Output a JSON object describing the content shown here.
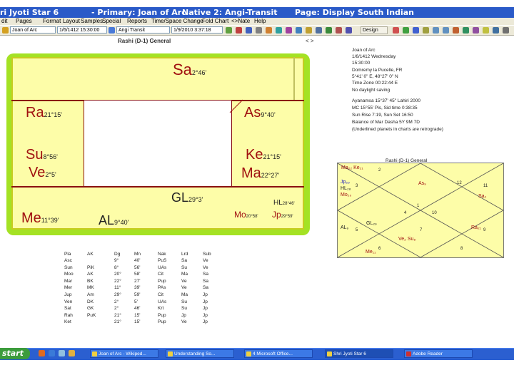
{
  "window": {
    "app": "ri Jyoti Star 6",
    "primary": "- Primary: Joan of Arc",
    "native2": "Native 2: Angi-Transit",
    "page": "Page: Display South Indian"
  },
  "menu": [
    "dit",
    "Pages",
    "Format",
    "Layout",
    "Samples",
    "Special",
    "Reports",
    "Time/Space Change",
    "Fold Chart",
    "<>Nate",
    "Help"
  ],
  "toolbar": {
    "native1": "Joan of Arc",
    "date1": "1/6/1412 15:30:00",
    "native2": "Angi Transit",
    "date2": "1/9/2010 3:37:18",
    "design_label": "Design"
  },
  "chart_header": {
    "title": "Rashi (D-1) General",
    "nav": "< >"
  },
  "south_chart": {
    "sa": {
      "name": "Sa",
      "deg": "2°46'"
    },
    "ra": {
      "name": "Ra",
      "deg": "21°15'"
    },
    "as": {
      "name": "As",
      "deg": "9°40'"
    },
    "su": {
      "name": "Su",
      "deg": "8°56'"
    },
    "ve": {
      "name": "Ve",
      "deg": "2°5'"
    },
    "ke": {
      "name": "Ke",
      "deg": "21°15'"
    },
    "ma": {
      "name": "Ma",
      "deg": "22°27'"
    },
    "gl": {
      "name": "GL",
      "deg": "29°3'"
    },
    "hl": {
      "name": "HL",
      "deg": "28°46'"
    },
    "me": {
      "name": "Me",
      "deg": "11°39'"
    },
    "al": {
      "name": "AL",
      "deg": "9°40'"
    },
    "mo": {
      "name": "Mo",
      "deg": "20°58'"
    },
    "jp": {
      "name": "Jp",
      "deg": "29°59'"
    }
  },
  "info": [
    "Joan of Arc",
    "1/6/1412 Wednesday",
    "15:30:00",
    "Domremy la Pucelle, FR",
    "5°41' 0\" E, 48°27' 0\" N",
    "Time Zone 00:22:44 E",
    "No daylight saving",
    "Ayanamsa 15°37' 45\" Lahiri 2000",
    "MC 15°55' Pis, Sid time 0:38:35",
    "Sun Rise 7:19, Sun Set 16:50",
    "Balance of Mar Dasha 5Y 9M 7D",
    "(Underlined planets in charts are retrograde)"
  ],
  "north_chart": {
    "title": "Rashi (D-1) General",
    "planets": {
      "ma_ke": "Ma₂₂ Ke₂₁",
      "jp": "Jp₂₉",
      "hl": "HL₂₈",
      "mo": "Mo₂₀",
      "as": "As₉",
      "sa": "Sa₂",
      "al": "AL₉",
      "gl": "GL₂₉",
      "ve_su": "Ve₂ Su₈",
      "me": "Me₁₁",
      "ra": "Ra₂₁"
    },
    "houses": [
      "1",
      "2",
      "3",
      "4",
      "5",
      "6",
      "7",
      "8",
      "9",
      "10",
      "11",
      "12"
    ]
  },
  "table": {
    "headers": [
      "Pla",
      "AK",
      "Dg",
      "Mn",
      "Nak",
      "Lrd",
      "Sub"
    ],
    "rows": [
      [
        "Asc",
        "",
        "9°",
        "40'",
        "PuS",
        "Sa",
        "Ve"
      ],
      [
        "Sun",
        "PiK",
        "8°",
        "56'",
        "UAs",
        "Su",
        "Ve"
      ],
      [
        "Moo",
        "AK",
        "20°",
        "58'",
        "Cit",
        "Ma",
        "Sa"
      ],
      [
        "Mar",
        "BK",
        "22°",
        "27'",
        "Pup",
        "Ve",
        "Sa"
      ],
      [
        "Mer",
        "MK",
        "11°",
        "39'",
        "PAs",
        "Ve",
        "Sa"
      ],
      [
        "Jup",
        "Am",
        "29°",
        "59'",
        "Cit",
        "Ma",
        "Jp"
      ],
      [
        "Ven",
        "DK",
        "2°",
        "5'",
        "UAs",
        "Su",
        "Jp"
      ],
      [
        "Sat",
        "GK",
        "2°",
        "46'",
        "Krt",
        "Su",
        "Jp"
      ],
      [
        "Rah",
        "PuK",
        "21°",
        "15'",
        "Pup",
        "Jp",
        "Jp"
      ],
      [
        "Ket",
        "",
        "21°",
        "15'",
        "Pup",
        "Ve",
        "Jp"
      ]
    ]
  },
  "taskbar": {
    "start": "start",
    "buttons": [
      "Joan of Arc - Wikiped...",
      "Understanding So...",
      "4 Microsoft Office...",
      "Shri Jyoti Star 6",
      "Adobe Reader"
    ]
  }
}
